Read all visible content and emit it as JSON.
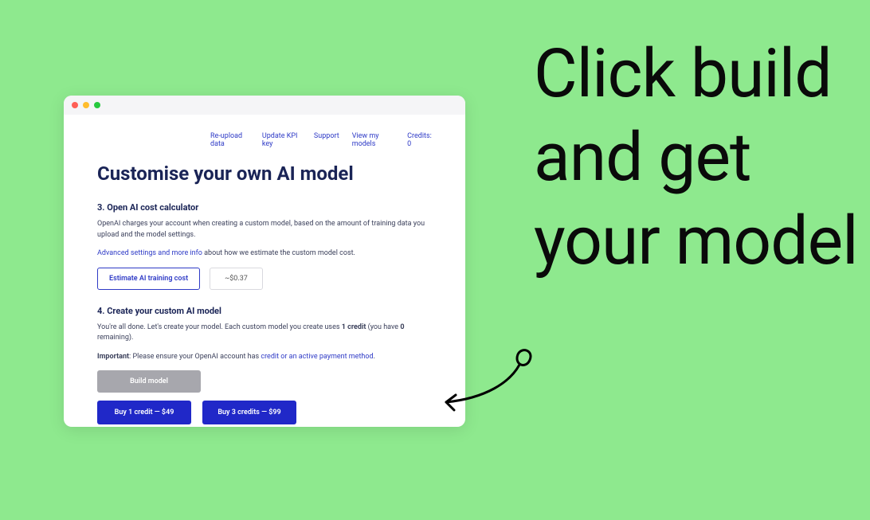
{
  "headline": "Click build and get your model",
  "nav": {
    "reupload": "Re-upload data",
    "update_key": "Update KPI key",
    "support": "Support",
    "view_models": "View my models",
    "credits": "Credits: 0"
  },
  "title": "Customise your own AI model",
  "section3": {
    "heading": "3. Open AI cost calculator",
    "desc": "OpenAI charges your account when creating a custom model, based on the amount of training data you upload and the model settings.",
    "link": "Advanced settings and more info",
    "link_suffix": " about how we estimate the custom model cost.",
    "estimate_btn": "Estimate AI training cost",
    "cost": "~$0.37"
  },
  "section4": {
    "heading": "4. Create your custom AI model",
    "line1_pre": "You're all done. Let's create your model. Each custom model you create uses ",
    "line1_bold1": "1 credit",
    "line1_mid": " (you have ",
    "line1_bold2": "0",
    "line1_post": " remaining).",
    "line2_bold": "Important",
    "line2_mid": ": Please ensure your OpenAI account has ",
    "line2_link": "credit or an active payment method",
    "line2_end": ".",
    "build_btn": "Build model",
    "buy1": "Buy 1 credit — $49",
    "buy3": "Buy 3 credits — $99"
  }
}
